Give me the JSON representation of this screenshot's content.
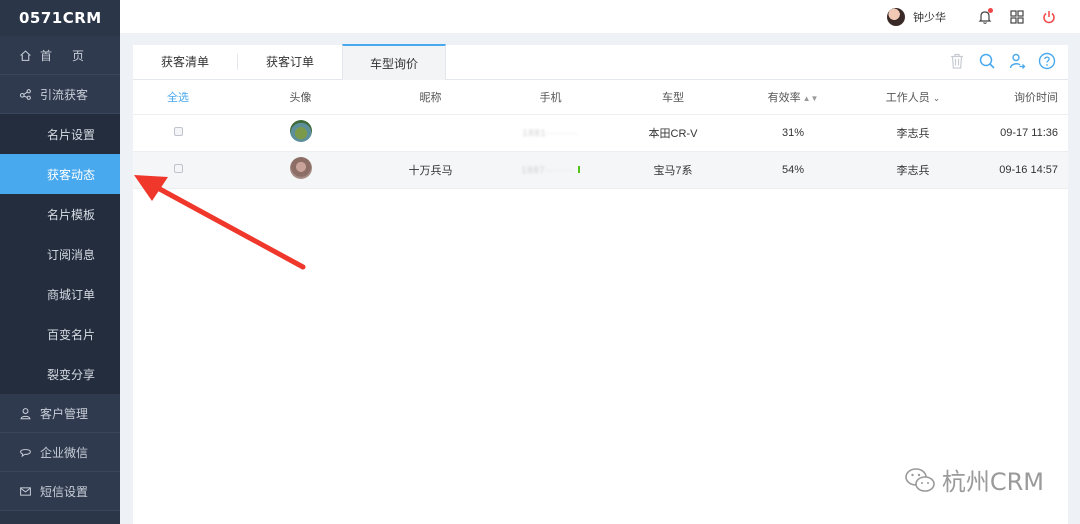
{
  "app": {
    "logo": "0571CRM"
  },
  "header": {
    "username": "钟少华"
  },
  "sidebar": {
    "items": [
      {
        "label": "首页",
        "icon": "home-icon",
        "level": "top"
      },
      {
        "label": "引流获客",
        "icon": "share-icon",
        "level": "top"
      },
      {
        "label": "名片设置",
        "level": "sub"
      },
      {
        "label": "获客动态",
        "level": "sub",
        "active": true
      },
      {
        "label": "名片模板",
        "level": "sub"
      },
      {
        "label": "订阅消息",
        "level": "sub"
      },
      {
        "label": "商城订单",
        "level": "sub"
      },
      {
        "label": "百变名片",
        "level": "sub"
      },
      {
        "label": "裂变分享",
        "level": "sub"
      },
      {
        "label": "客户管理",
        "icon": "user-icon",
        "level": "top"
      },
      {
        "label": "企业微信",
        "icon": "chat-icon",
        "level": "top"
      },
      {
        "label": "短信设置",
        "icon": "mail-icon",
        "level": "top"
      }
    ]
  },
  "tabs": [
    {
      "label": "获客清单"
    },
    {
      "label": "获客订单"
    },
    {
      "label": "车型询价",
      "active": true
    }
  ],
  "table": {
    "columns": [
      "全选",
      "头像",
      "昵称",
      "手机",
      "车型",
      "有效率",
      "工作人员",
      "询价时间"
    ],
    "rows": [
      {
        "nickname": "",
        "phone": "1881········",
        "car": "本田CR-V",
        "rate": "31%",
        "staff": "李志兵",
        "time": "09-17 11:36"
      },
      {
        "nickname": "十万兵马",
        "phone": "1887·······",
        "car": "宝马7系",
        "rate": "54%",
        "staff": "李志兵",
        "time": "09-16 14:57"
      }
    ]
  },
  "watermark": {
    "text": "杭州CRM"
  },
  "colors": {
    "sidebar": "#2b3649",
    "active": "#49a9ee",
    "arrow": "#f0372b"
  }
}
